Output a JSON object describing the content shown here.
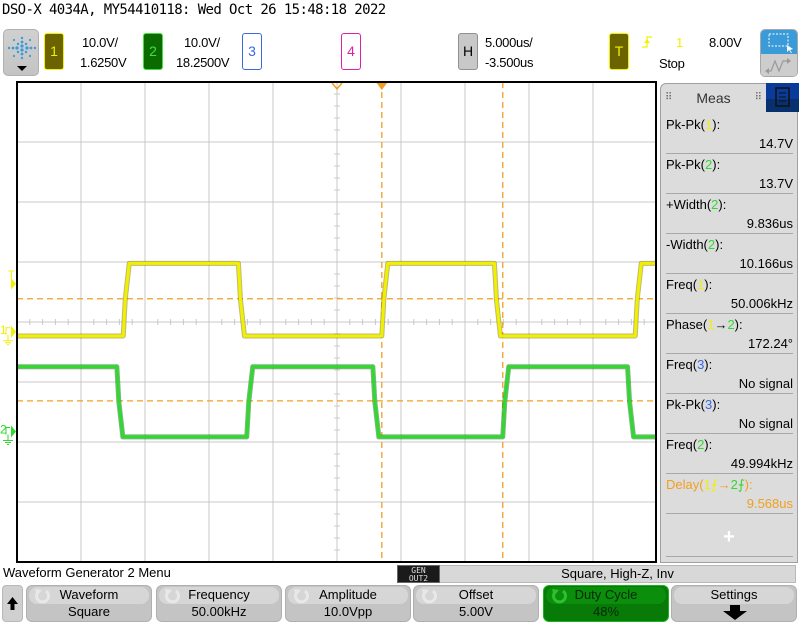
{
  "title": "DSO-X 4034A, MY54410118: Wed Oct 26 15:48:18 2022",
  "colors": {
    "ch1": "#f0f000",
    "ch2": "#30d830",
    "ch3": "#3a68e0",
    "ch4": "#e020a0",
    "marker": "#f0a020",
    "grid": "#c8c8c8"
  },
  "channels": [
    {
      "number": "1",
      "scale": "10.0V/",
      "offset": "1.6250V"
    },
    {
      "number": "2",
      "scale": "10.0V/",
      "offset": "18.2500V"
    },
    {
      "number": "3"
    },
    {
      "number": "4"
    }
  ],
  "horizontal": {
    "label": "H",
    "scale": "5.000us/",
    "delay": "-3.500us"
  },
  "trigger": {
    "label": "T",
    "source": "1",
    "level": "8.00V",
    "state": "Stop",
    "slope_icon": "rising-edge-icon"
  },
  "meas_panel": {
    "tab_label": "Meas",
    "items": [
      {
        "prefix": "Pk-Pk(",
        "ch": "1",
        "suffix": "):",
        "value": "14.7V"
      },
      {
        "prefix": "Pk-Pk(",
        "ch": "2",
        "suffix": "):",
        "value": "13.7V"
      },
      {
        "prefix": "+Width(",
        "ch": "2",
        "suffix": "):",
        "value": "9.836us"
      },
      {
        "prefix": "-Width(",
        "ch": "2",
        "suffix": "):",
        "value": "10.166us"
      },
      {
        "prefix": "Freq(",
        "ch": "1",
        "suffix": "):",
        "value": "50.006kHz"
      },
      {
        "prefix": "Phase(",
        "ch": "1",
        "mid": "→",
        "ch_b": "2",
        "suffix": "):",
        "value": "172.24°"
      },
      {
        "prefix": "Freq(",
        "ch": "3",
        "suffix": "):",
        "value": "No signal"
      },
      {
        "prefix": "Pk-Pk(",
        "ch": "3",
        "suffix": "):",
        "value": "No signal"
      },
      {
        "prefix": "Freq(",
        "ch": "2",
        "suffix": "):",
        "value": "49.994kHz"
      },
      {
        "prefix": "Delay(",
        "ch": "1",
        "mid": "→",
        "ch_b": "2",
        "suffix": "):",
        "value": "9.568us",
        "highlight": true
      }
    ],
    "add_label": "+"
  },
  "waveforms": {
    "time_per_div_us": 5,
    "center_time_us": -3.5,
    "volts_per_div": 10,
    "ch1": {
      "offset_v": 1.625,
      "high_v": 11.4,
      "low_v": -0.7,
      "initial": "low",
      "edges_us": [
        -20.2,
        -11.2,
        0.0,
        8.8,
        19.8
      ]
    },
    "ch2": {
      "offset_v": 18.25,
      "high_v": 10.8,
      "low_v": -0.9,
      "initial": "high",
      "edges_us": [
        -20.7,
        -10.55,
        -0.7,
        9.45,
        19.2
      ]
    },
    "trigger_level_v": 8.0,
    "threshold_ch1_v": 5.5,
    "threshold_ch2_v": 5.1,
    "cursor_times_us": [
      0.0,
      9.45
    ]
  },
  "menu": {
    "title": "Waveform Generator 2 Menu",
    "gen_out_label_1": "GEN",
    "gen_out_label_2": "OUT2",
    "status": "Square, High-Z, Inv",
    "softkeys": [
      {
        "label": "Waveform",
        "value": "Square",
        "icon": "rotate-knob-icon"
      },
      {
        "label": "Frequency",
        "value": "50.00kHz",
        "icon": "rotate-knob-icon"
      },
      {
        "label": "Amplitude",
        "value": "10.0Vpp",
        "icon": "rotate-knob-icon"
      },
      {
        "label": "Offset",
        "value": "5.00V",
        "icon": "rotate-knob-icon"
      },
      {
        "label": "Duty Cycle",
        "value": "48%",
        "icon": "rotate-knob-icon",
        "active": true
      },
      {
        "label": "Settings",
        "icon": "down-arrow-icon"
      }
    ]
  }
}
